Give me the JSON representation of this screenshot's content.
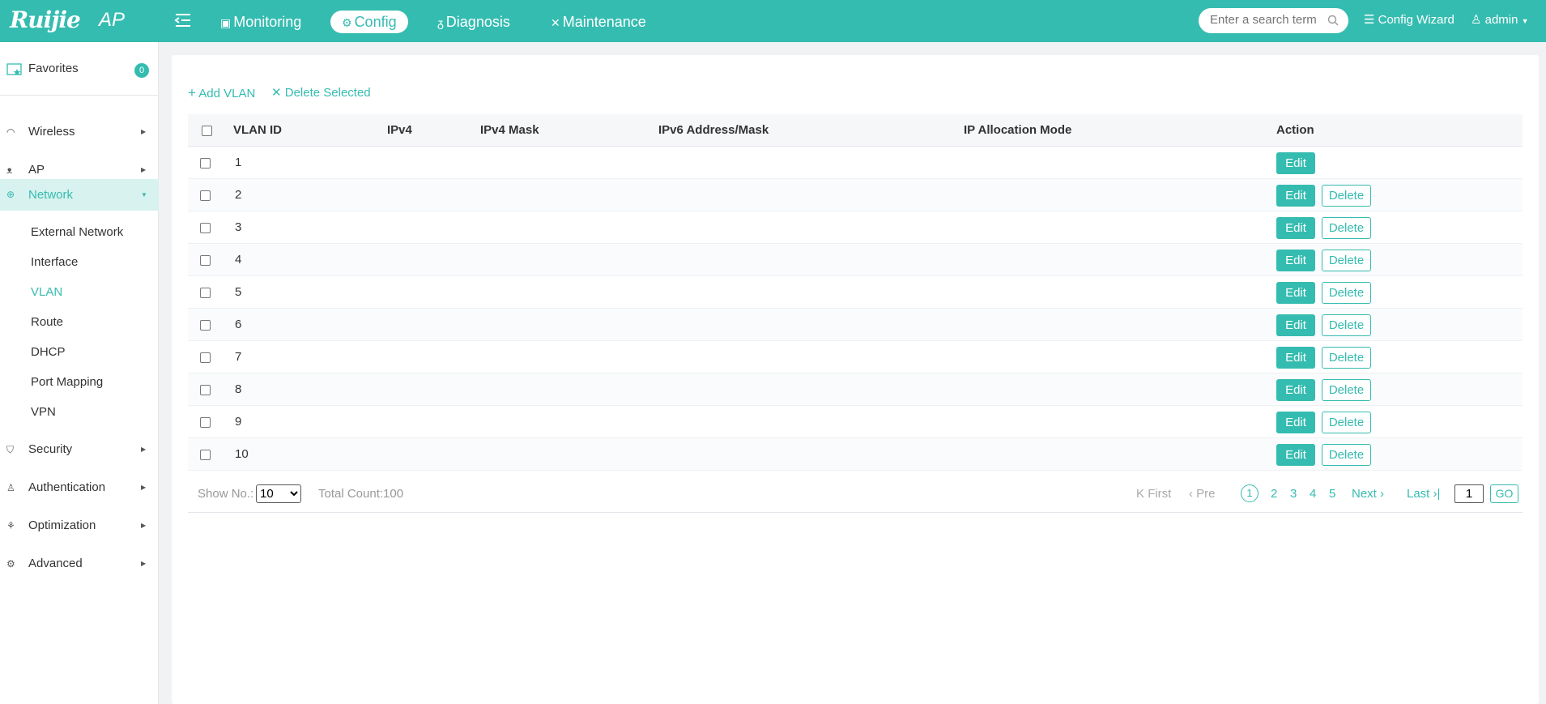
{
  "brand": {
    "logo_text": "Ruijie",
    "product": "AP"
  },
  "nav": [
    {
      "label": "Monitoring",
      "icon": "monitor-icon"
    },
    {
      "label": "Config",
      "icon": "gear-icon",
      "active": true
    },
    {
      "label": "Diagnosis",
      "icon": "stethoscope-icon"
    },
    {
      "label": "Maintenance",
      "icon": "tools-icon"
    }
  ],
  "search": {
    "placeholder": "Enter a search term"
  },
  "top_right": {
    "config_wizard": "Config Wizard",
    "user": "admin"
  },
  "sidebar": {
    "favorites": {
      "label": "Favorites",
      "count": "0"
    },
    "items": [
      {
        "label": "Wireless"
      },
      {
        "label": "AP"
      },
      {
        "label": "Network",
        "active": true
      },
      {
        "label": "Security"
      },
      {
        "label": "Authentication"
      },
      {
        "label": "Optimization"
      },
      {
        "label": "Advanced"
      }
    ],
    "network_sub": [
      {
        "label": "External Network"
      },
      {
        "label": "Interface"
      },
      {
        "label": "VLAN",
        "active": true
      },
      {
        "label": "Route"
      },
      {
        "label": "DHCP"
      },
      {
        "label": "Port Mapping"
      },
      {
        "label": "VPN"
      }
    ]
  },
  "toolbar": {
    "add_label": "Add VLAN",
    "delete_label": "Delete Selected"
  },
  "table": {
    "headers": [
      "VLAN ID",
      "IPv4",
      "IPv4 Mask",
      "IPv6 Address/Mask",
      "IP Allocation Mode",
      "Action"
    ],
    "rows": [
      {
        "vlan_id": "1",
        "edit": "Edit",
        "delete": ""
      },
      {
        "vlan_id": "2",
        "edit": "Edit",
        "delete": "Delete"
      },
      {
        "vlan_id": "3",
        "edit": "Edit",
        "delete": "Delete"
      },
      {
        "vlan_id": "4",
        "edit": "Edit",
        "delete": "Delete"
      },
      {
        "vlan_id": "5",
        "edit": "Edit",
        "delete": "Delete"
      },
      {
        "vlan_id": "6",
        "edit": "Edit",
        "delete": "Delete"
      },
      {
        "vlan_id": "7",
        "edit": "Edit",
        "delete": "Delete"
      },
      {
        "vlan_id": "8",
        "edit": "Edit",
        "delete": "Delete"
      },
      {
        "vlan_id": "9",
        "edit": "Edit",
        "delete": "Delete"
      },
      {
        "vlan_id": "10",
        "edit": "Edit",
        "delete": "Delete"
      }
    ]
  },
  "pagination": {
    "show_label": "Show No.:",
    "page_size": "10",
    "total": "Total Count:100",
    "first": "First",
    "prev": "Pre",
    "pages": [
      "1",
      "2",
      "3",
      "4",
      "5"
    ],
    "current": "1",
    "next": "Next",
    "last": "Last",
    "goto_value": "1",
    "go_label": "GO"
  },
  "colors": {
    "accent": "#35bcb0"
  }
}
